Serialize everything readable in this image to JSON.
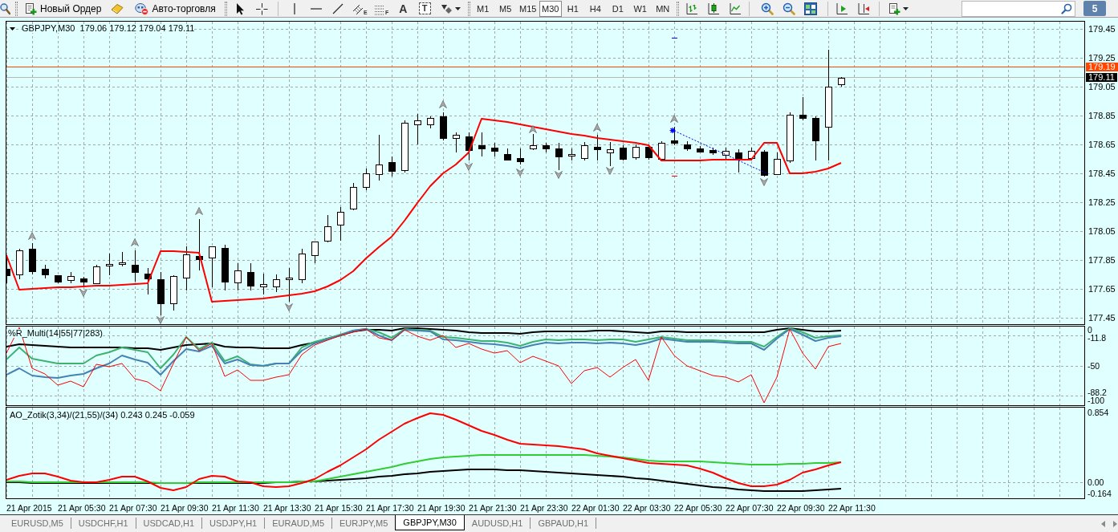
{
  "toolbar": {
    "new_order": "Новый Ордер",
    "auto_trading": {
      "label": "Авто-торговля",
      "on": false
    },
    "tool_letters": {
      "channel": "E",
      "fibonacci": "F",
      "text": "A",
      "label": "T"
    },
    "timeframes": [
      {
        "label": "M1",
        "selected": false
      },
      {
        "label": "M5",
        "selected": false
      },
      {
        "label": "M15",
        "selected": false
      },
      {
        "label": "M30",
        "selected": true
      },
      {
        "label": "H1",
        "selected": false
      },
      {
        "label": "H4",
        "selected": false
      },
      {
        "label": "D1",
        "selected": false
      },
      {
        "label": "W1",
        "selected": false
      },
      {
        "label": "MN",
        "selected": false
      }
    ],
    "messages_badge": "5"
  },
  "chart": {
    "title": "GBPJPY,M30  179.06 179.12 179.04 179.11",
    "price_axis": {
      "labels": [
        "179.45",
        "179.25",
        "179.05",
        "178.85",
        "178.65",
        "178.45",
        "178.25",
        "178.05",
        "177.85",
        "177.65",
        "177.45"
      ],
      "markers": [
        {
          "text": "179.19",
          "kind": "alert"
        },
        {
          "text": "179.11",
          "kind": "bid"
        }
      ]
    },
    "indicators": [
      {
        "kind": "percent_r",
        "label": "%R_Multi(14|55|77|283)",
        "axis_labels": [
          "0",
          "-11.8",
          "-50",
          "-88.2",
          "-100"
        ]
      },
      {
        "kind": "oscillator",
        "label": "AO_Zotik(3,34)/(21,55)/(34) 0.243 0.245 -0.059",
        "axis_labels": [
          "0.854",
          "0.00",
          "-0.164"
        ]
      }
    ],
    "time_axis": [
      "21 Apr 2015",
      "21 Apr 05:30",
      "21 Apr 07:30",
      "21 Apr 09:30",
      "21 Apr 11:30",
      "21 Apr 13:30",
      "21 Apr 15:30",
      "21 Apr 17:30",
      "21 Apr 19:30",
      "21 Apr 21:30",
      "21 Apr 23:30",
      "22 Apr 01:30",
      "22 Apr 03:30",
      "22 Apr 05:30",
      "22 Apr 07:30",
      "22 Apr 09:30",
      "22 Apr 11:30"
    ]
  },
  "tabs": [
    {
      "label": "EURUSD,M5",
      "selected": false
    },
    {
      "label": "USDCHF,H1",
      "selected": false
    },
    {
      "label": "USDCAD,H1",
      "selected": false
    },
    {
      "label": "USDJPY,H1",
      "selected": false
    },
    {
      "label": "EURAUD,M5",
      "selected": false
    },
    {
      "label": "EURJPY,M5",
      "selected": false
    },
    {
      "label": "GBPJPY,M30",
      "selected": true
    },
    {
      "label": "AUDUSD,H1",
      "selected": false
    },
    {
      "label": "GBPAUD,H1",
      "selected": false
    }
  ]
}
